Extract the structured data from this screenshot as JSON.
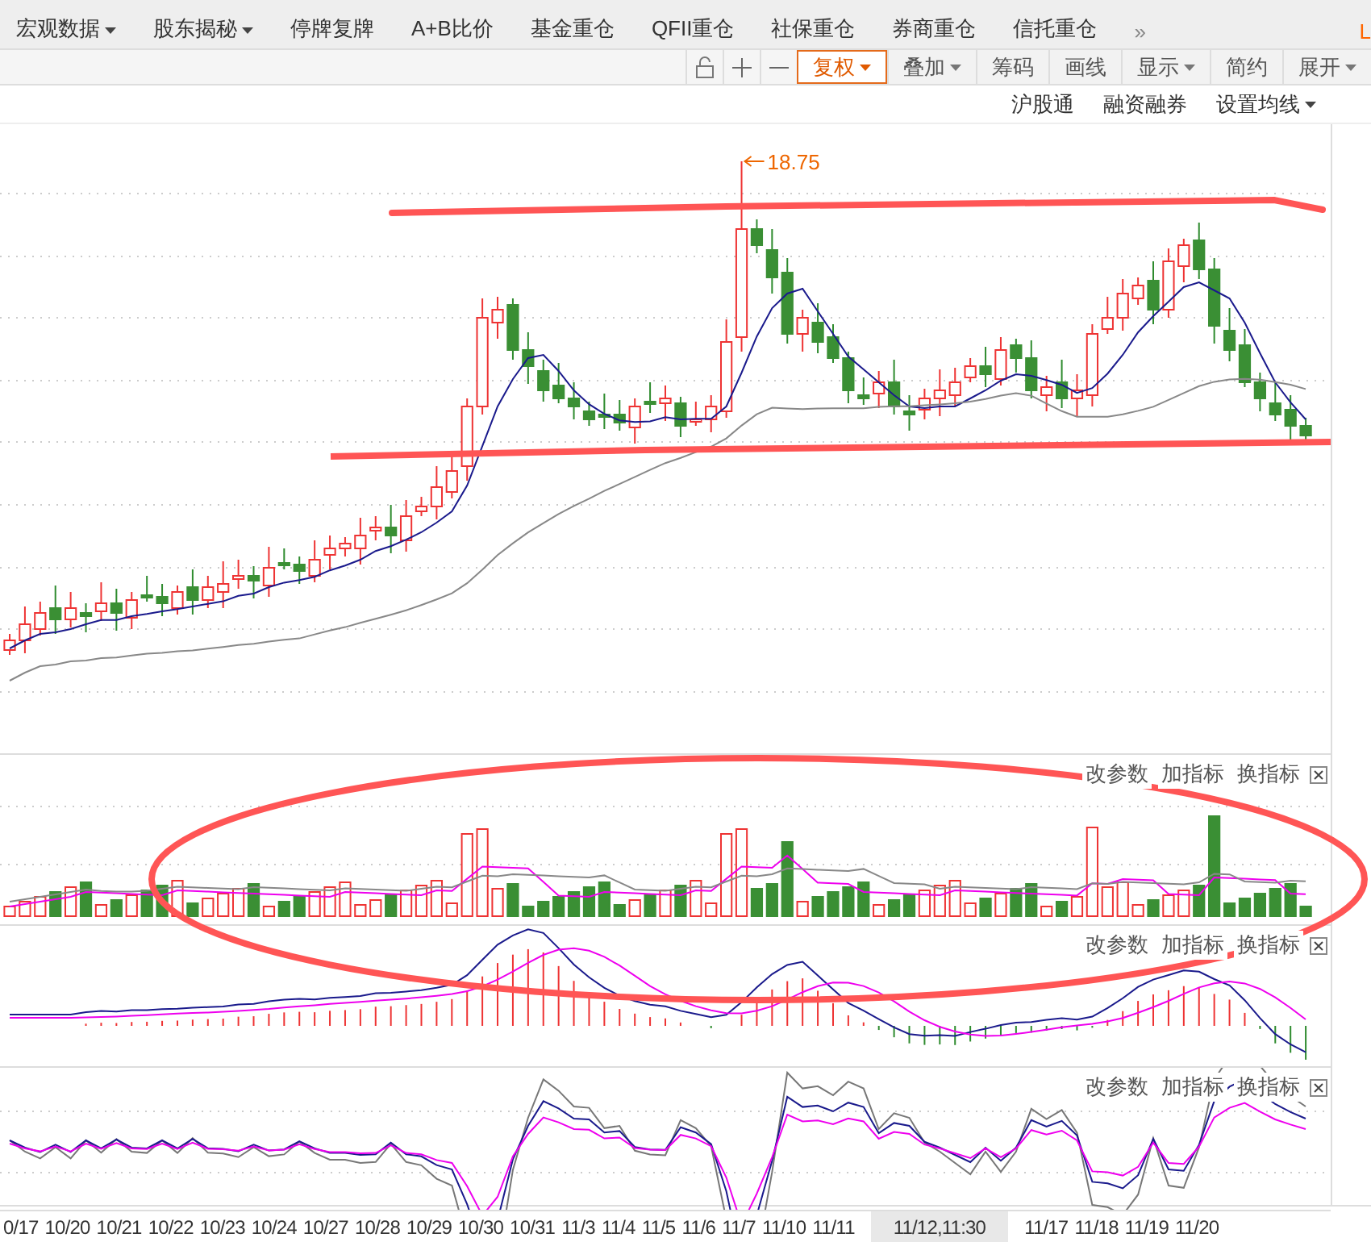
{
  "menu": [
    {
      "label": "宏观数据",
      "dropdown": true
    },
    {
      "label": "股东揭秘",
      "dropdown": true
    },
    {
      "label": "停牌复牌",
      "dropdown": false
    },
    {
      "label": "A+B比价",
      "dropdown": false
    },
    {
      "label": "基金重仓",
      "dropdown": false
    },
    {
      "label": "QFII重仓",
      "dropdown": false
    },
    {
      "label": "社保重仓",
      "dropdown": false
    },
    {
      "label": "券商重仓",
      "dropdown": false
    },
    {
      "label": "信托重仓",
      "dropdown": false
    }
  ],
  "menu_more": "»",
  "corner_label": "L",
  "toolbar": [
    {
      "label": "复权",
      "dropdown": true,
      "selected": true
    },
    {
      "label": "叠加",
      "dropdown": true,
      "selected": false
    },
    {
      "label": "筹码",
      "dropdown": false,
      "selected": false
    },
    {
      "label": "画线",
      "dropdown": false,
      "selected": false
    },
    {
      "label": "显示",
      "dropdown": true,
      "selected": false
    },
    {
      "label": "简约",
      "dropdown": false,
      "selected": false
    },
    {
      "label": "展开",
      "dropdown": true,
      "selected": false
    }
  ],
  "chart_links": [
    {
      "label": "沪股通",
      "dropdown": false
    },
    {
      "label": "融资融券",
      "dropdown": false
    },
    {
      "label": "设置均线",
      "dropdown": true
    }
  ],
  "high_label": "18.75",
  "panels": [
    {
      "kind": "volume",
      "actions": [
        "改参数",
        "加指标",
        "换指标"
      ]
    },
    {
      "kind": "macd",
      "actions": [
        "改参数",
        "加指标",
        "换指标"
      ]
    },
    {
      "kind": "kdj",
      "actions": [
        "改参数",
        "加指标",
        "换指标"
      ]
    }
  ],
  "dates": [
    {
      "label": "0/17",
      "selected": false
    },
    {
      "label": "10/20",
      "selected": false
    },
    {
      "label": "10/21",
      "selected": false
    },
    {
      "label": "10/22",
      "selected": false
    },
    {
      "label": "10/23",
      "selected": false
    },
    {
      "label": "10/24",
      "selected": false
    },
    {
      "label": "10/27",
      "selected": false
    },
    {
      "label": "10/28",
      "selected": false
    },
    {
      "label": "10/29",
      "selected": false
    },
    {
      "label": "10/30",
      "selected": false
    },
    {
      "label": "10/31",
      "selected": false
    },
    {
      "label": "11/3",
      "selected": false
    },
    {
      "label": "11/4",
      "selected": false
    },
    {
      "label": "11/5",
      "selected": false
    },
    {
      "label": "11/6",
      "selected": false
    },
    {
      "label": "11/7",
      "selected": false
    },
    {
      "label": "11/10",
      "selected": false
    },
    {
      "label": "11/11",
      "selected": false
    },
    {
      "label": "11/12,11:30",
      "selected": true
    },
    {
      "label": "11/17",
      "selected": false
    },
    {
      "label": "11/18",
      "selected": false
    },
    {
      "label": "11/19",
      "selected": false
    },
    {
      "label": "11/20",
      "selected": false
    }
  ]
}
